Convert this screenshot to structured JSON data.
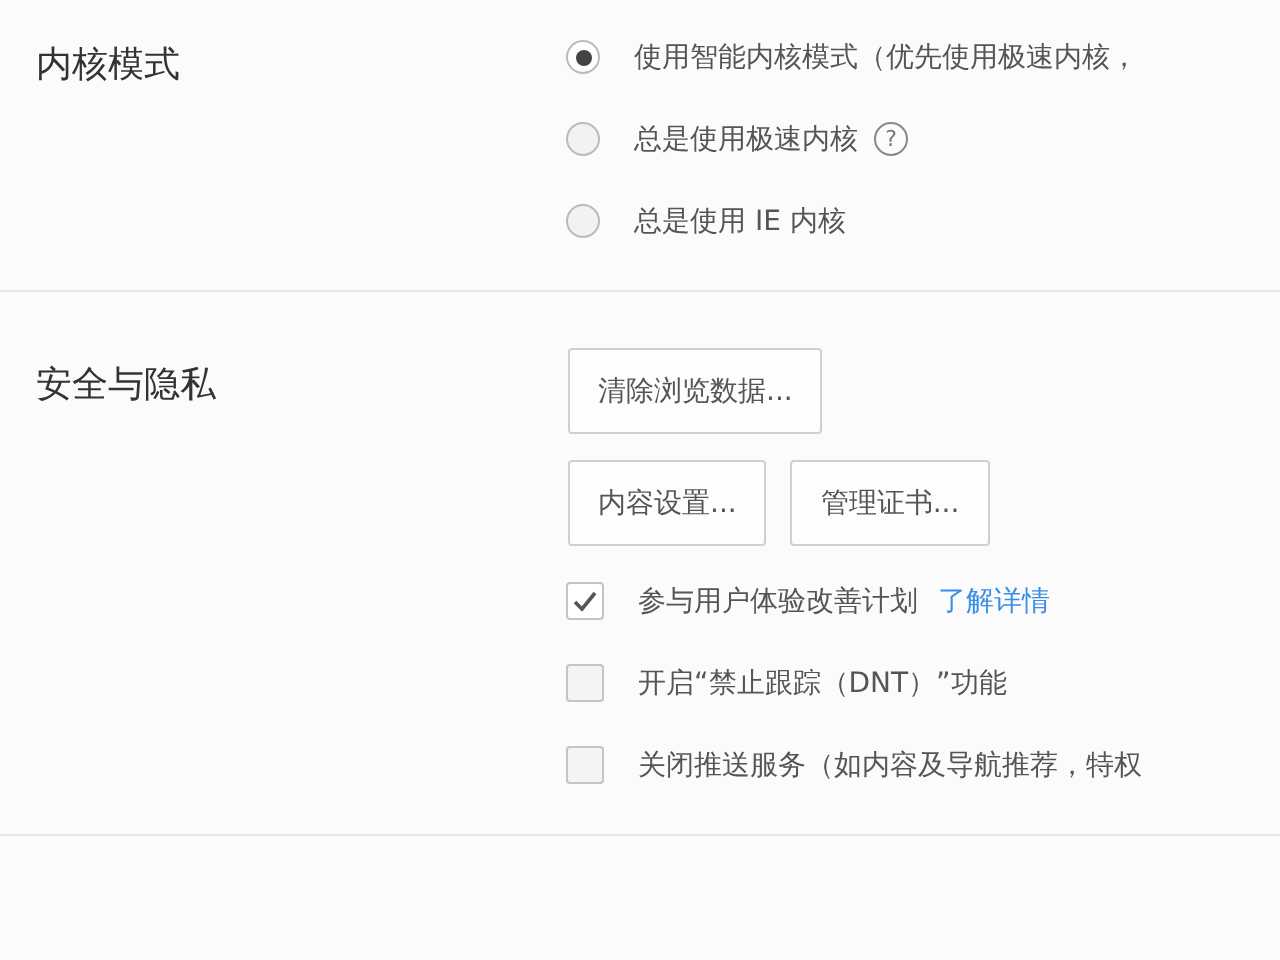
{
  "sections": [
    {
      "title": "内核模式",
      "items": [
        {
          "kind": "radio",
          "label": "使用智能内核模式（优先使用极速内核，",
          "selected": true
        },
        {
          "kind": "radio",
          "label": "总是使用极速内核",
          "selected": false,
          "help": "?"
        },
        {
          "kind": "radio",
          "label": "总是使用 IE 内核",
          "selected": false
        }
      ]
    },
    {
      "title": "安全与隐私",
      "items": [
        {
          "kind": "buttons",
          "buttons": [
            "清除浏览数据..."
          ]
        },
        {
          "kind": "buttons",
          "buttons": [
            "内容设置...",
            "管理证书..."
          ]
        },
        {
          "kind": "checkbox",
          "label": "参与用户体验改善计划",
          "checked": true,
          "link": "了解详情"
        },
        {
          "kind": "checkbox",
          "label": "开启“禁止跟踪（DNT）”功能",
          "checked": false
        },
        {
          "kind": "checkbox",
          "label": "关闭推送服务（如内容及导航推荐，特权",
          "checked": false
        }
      ]
    }
  ]
}
